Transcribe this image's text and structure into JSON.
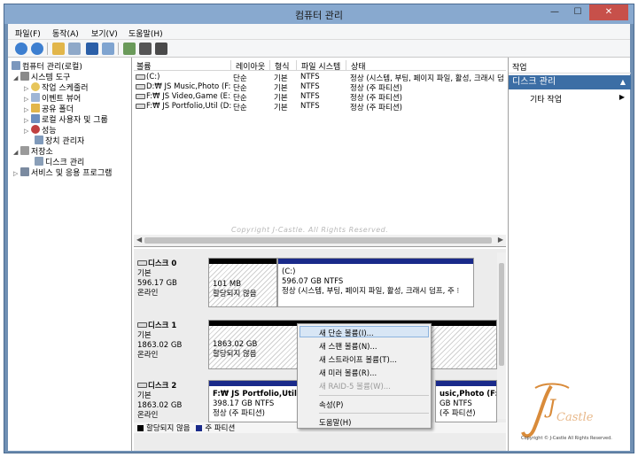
{
  "window": {
    "title": "컴퓨터 관리",
    "min": "—",
    "max": "☐",
    "close": "✕"
  },
  "menu": [
    "파일(F)",
    "동작(A)",
    "보기(V)",
    "도움말(H)"
  ],
  "colors": {
    "titlebar": "#88a9cf",
    "frame": "#6f8fb3",
    "selection": "#3c6ea5",
    "primary_partition": "#1a2a8a",
    "unallocated": "#000000"
  },
  "tree": {
    "root": "컴퓨터 관리(로컬)",
    "items": [
      {
        "label": "시스템 도구",
        "icon": "tools-icon"
      },
      {
        "label": "작업 스케줄러",
        "icon": "clock-icon"
      },
      {
        "label": "이벤트 뷰어",
        "icon": "event-viewer-icon"
      },
      {
        "label": "공유 폴더",
        "icon": "shared-folder-icon"
      },
      {
        "label": "로컬 사용자 및 그룹",
        "icon": "users-icon"
      },
      {
        "label": "성능",
        "icon": "performance-icon"
      },
      {
        "label": "장치 관리자",
        "icon": "device-manager-icon"
      },
      {
        "label": "저장소",
        "icon": "storage-icon"
      },
      {
        "label": "디스크 관리",
        "icon": "disk-management-icon"
      },
      {
        "label": "서비스 및 응용 프로그램",
        "icon": "services-icon"
      }
    ]
  },
  "volumes": {
    "headers": [
      "볼륨",
      "레이아웃",
      "형식",
      "파일 시스템",
      "상태"
    ],
    "rows": [
      [
        "(C:)",
        "단순",
        "기본",
        "NTFS",
        "정상 (시스템, 부팅, 페이지 파일, 활성, 크래시 덤"
      ],
      [
        "D:₩ JS Music,Photo (F:)",
        "단순",
        "기본",
        "NTFS",
        "정상 (주 파티션)"
      ],
      [
        "F:₩ JS Video,Game (E:)",
        "단순",
        "기본",
        "NTFS",
        "정상 (주 파티션)"
      ],
      [
        "F:₩ JS Portfolio,Util (D:)",
        "단순",
        "기본",
        "NTFS",
        "정상 (주 파티션)"
      ]
    ]
  },
  "watermark": "Copyright J-Castle. All Rights Reserved.",
  "disks": [
    {
      "name": "디스크 0",
      "type": "기본",
      "size": "596.17 GB",
      "status": "온라인",
      "parts": [
        {
          "l1": "101 MB",
          "l2": "할당되지 않음",
          "l3": ""
        },
        {
          "l1": "(C:)",
          "l2": "596.07 GB NTFS",
          "l3": "정상 (시스템, 부팅, 페이지 파일, 활성, 크래시 덤프, 주 ⁝"
        }
      ]
    },
    {
      "name": "디스크 1",
      "type": "기본",
      "size": "1863.02 GB",
      "status": "온라인",
      "parts": [
        {
          "l1": "1863.02 GB",
          "l2": "할당되지 않음",
          "l3": ""
        }
      ]
    },
    {
      "name": "디스크 2",
      "type": "기본",
      "size": "1863.02 GB",
      "status": "온라인",
      "parts": [
        {
          "l1": "F:₩ JS Portfolio,Util  (D:",
          "l2": "398.17 GB NTFS",
          "l3": "정상 (주 파티션)"
        },
        {
          "l1": "usic,Photo  (F:)",
          "l2": "GB NTFS",
          "l3": "(주 파티션)"
        }
      ]
    }
  ],
  "legend": {
    "unallocated": "할당되지 않음",
    "primary": "주 파티션"
  },
  "actions": {
    "header": "작업",
    "section": "디스크 관리",
    "item": "기타 작업"
  },
  "context_menu": {
    "items": [
      "새 단순 볼륨(I)...",
      "새 스팬 볼륨(N)...",
      "새 스트라이프 볼륨(T)...",
      "새 미러 볼륨(R)...",
      "새 RAID-5 볼륨(W)..."
    ],
    "properties": "속성(P)",
    "help": "도움말(H)"
  },
  "logo": {
    "letter": "J",
    "text": "Castle",
    "copyright": "Copyright © J-Castle All Rights Reserved."
  }
}
